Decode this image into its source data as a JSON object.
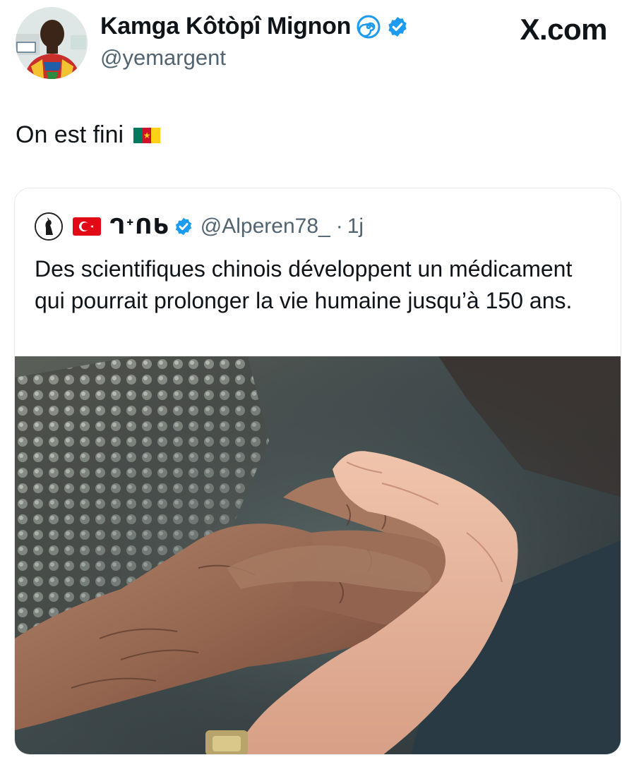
{
  "author": {
    "name": "Kamga Kôtòpî Mignon",
    "handle": "@yemargent",
    "verified": true
  },
  "brand": "X.com",
  "tweet": {
    "text": "On est fini",
    "flag": "cameroon-flag"
  },
  "quoted": {
    "name": "ᒉᐩᑎᑲ",
    "handle": "@Alperen78_",
    "separator": "·",
    "time": "1j",
    "text": "Des scientifiques chinois développent un médicament qui pourrait prolonger la vie humaine jusqu’à 150 ans.",
    "verified": true
  },
  "colors": {
    "verified_blue": "#1d9bf0",
    "handle_gray": "#536471",
    "text": "#0f1419",
    "turkey_red": "#e30a17"
  }
}
